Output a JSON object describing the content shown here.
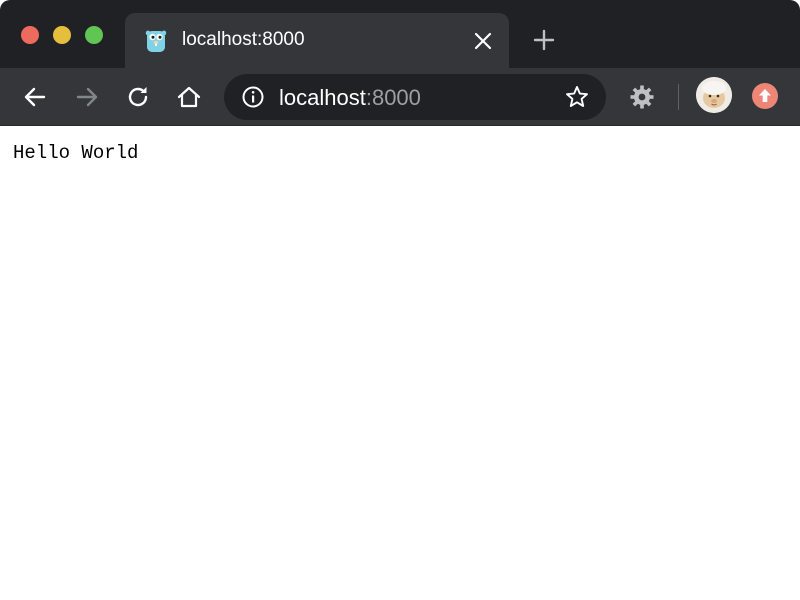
{
  "window": {
    "controls": [
      "close",
      "minimize",
      "maximize"
    ]
  },
  "tab": {
    "title": "localhost:8000",
    "favicon": "gopher-icon"
  },
  "toolbar": {
    "buttons": [
      "back-icon",
      "forward-icon",
      "reload-icon",
      "home-icon",
      "bookmark-star-icon",
      "extension-gear-icon",
      "avatar",
      "update-icon"
    ]
  },
  "omnibox": {
    "host": "localhost",
    "port": ":8000"
  },
  "page": {
    "text": "Hello World"
  },
  "colors": {
    "titlebar": "#202124",
    "tab": "#35363a",
    "close": "#ed6a5e",
    "minimize": "#e6be3d",
    "maximize": "#61c554",
    "update": "#ee8677"
  }
}
